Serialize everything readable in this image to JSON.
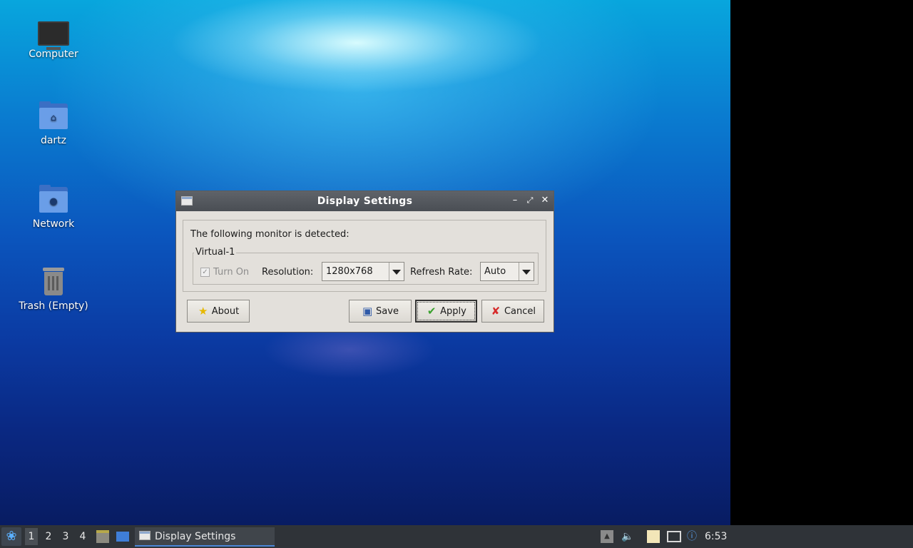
{
  "desktop": {
    "icons": [
      {
        "label": "Computer",
        "icon": "computer-icon"
      },
      {
        "label": "dartz",
        "icon": "home-folder-icon"
      },
      {
        "label": "Network",
        "icon": "network-folder-icon"
      },
      {
        "label": "Trash (Empty)",
        "icon": "trash-icon"
      }
    ]
  },
  "dialog": {
    "title": "Display Settings",
    "detected_text": "The following monitor is detected:",
    "monitor_name": "Virtual-1",
    "turn_on_label": "Turn On",
    "turn_on_checked": true,
    "resolution_label": "Resolution:",
    "resolution_value": "1280x768",
    "refresh_label": "Refresh Rate:",
    "refresh_value": "Auto",
    "buttons": {
      "about": "About",
      "save": "Save",
      "apply": "Apply",
      "cancel": "Cancel"
    }
  },
  "taskbar": {
    "workspaces": [
      "1",
      "2",
      "3",
      "4"
    ],
    "active_workspace": "1",
    "task_label": "Display Settings",
    "clock": "6:53"
  },
  "colors": {
    "taskbar_bg": "#2f3338",
    "titlebar_bg": "#4a4e54",
    "dialog_bg": "#e3e0db",
    "accent": "#4a86d8"
  }
}
